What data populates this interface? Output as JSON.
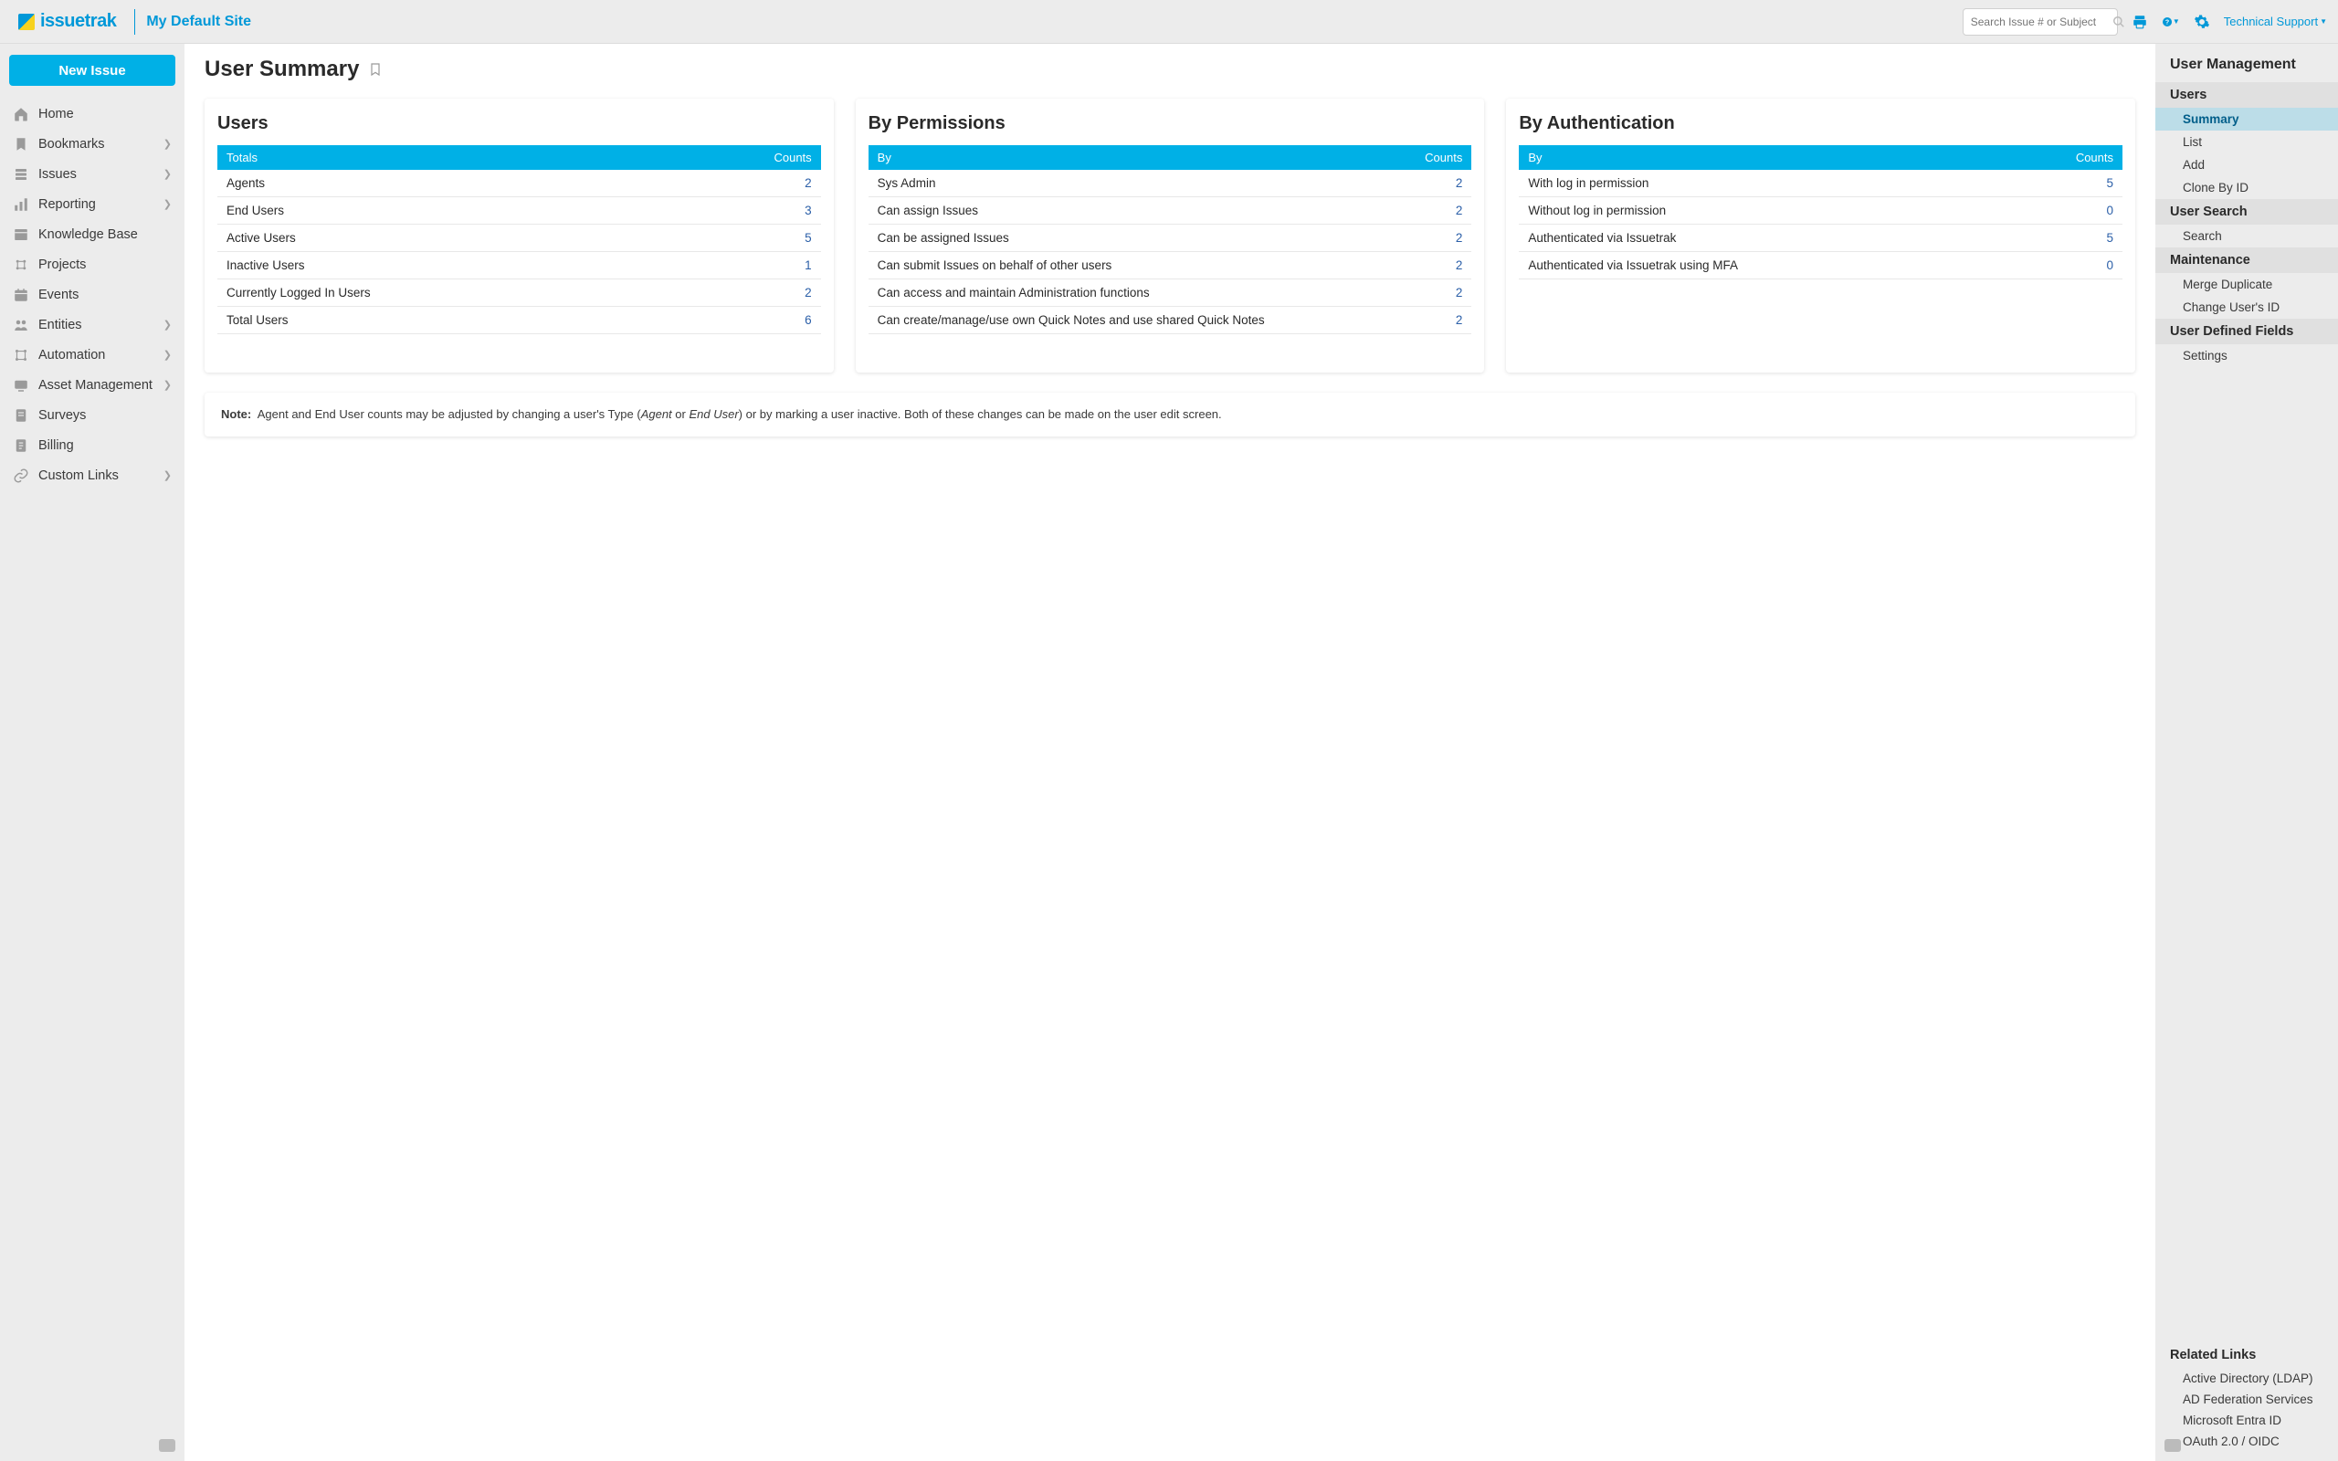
{
  "topbar": {
    "logo_text": "issuetrak",
    "site_name": "My Default Site",
    "search_placeholder": "Search Issue # or Subject",
    "tech_support": "Technical Support"
  },
  "left_nav": {
    "new_issue": "New Issue",
    "items": [
      {
        "label": "Home",
        "icon": "home",
        "expandable": false
      },
      {
        "label": "Bookmarks",
        "icon": "bookmark",
        "expandable": true
      },
      {
        "label": "Issues",
        "icon": "issues",
        "expandable": true
      },
      {
        "label": "Reporting",
        "icon": "reporting",
        "expandable": true
      },
      {
        "label": "Knowledge Base",
        "icon": "kb",
        "expandable": false
      },
      {
        "label": "Projects",
        "icon": "projects",
        "expandable": false
      },
      {
        "label": "Events",
        "icon": "events",
        "expandable": false
      },
      {
        "label": "Entities",
        "icon": "entities",
        "expandable": true
      },
      {
        "label": "Automation",
        "icon": "automation",
        "expandable": true
      },
      {
        "label": "Asset Management",
        "icon": "assets",
        "expandable": true
      },
      {
        "label": "Surveys",
        "icon": "surveys",
        "expandable": false
      },
      {
        "label": "Billing",
        "icon": "billing",
        "expandable": false
      },
      {
        "label": "Custom Links",
        "icon": "links",
        "expandable": true
      }
    ]
  },
  "page": {
    "title": "User Summary"
  },
  "cards": {
    "users": {
      "title": "Users",
      "head_l": "Totals",
      "head_r": "Counts",
      "rows": [
        {
          "label": "Agents",
          "count": "2"
        },
        {
          "label": "End Users",
          "count": "3"
        },
        {
          "label": "Active Users",
          "count": "5"
        },
        {
          "label": "Inactive Users",
          "count": "1"
        },
        {
          "label": "Currently Logged In Users",
          "count": "2"
        },
        {
          "label": "Total Users",
          "count": "6"
        }
      ]
    },
    "permissions": {
      "title": "By Permissions",
      "head_l": "By",
      "head_r": "Counts",
      "rows": [
        {
          "label": "Sys Admin",
          "count": "2"
        },
        {
          "label": "Can assign Issues",
          "count": "2"
        },
        {
          "label": "Can be assigned Issues",
          "count": "2"
        },
        {
          "label": "Can submit Issues on behalf of other users",
          "count": "2"
        },
        {
          "label": "Can access and maintain Administration functions",
          "count": "2"
        },
        {
          "label": "Can create/manage/use own Quick Notes and use shared Quick Notes",
          "count": "2"
        }
      ]
    },
    "auth": {
      "title": "By Authentication",
      "head_l": "By",
      "head_r": "Counts",
      "rows": [
        {
          "label": "With log in permission",
          "count": "5"
        },
        {
          "label": "Without log in permission",
          "count": "0"
        },
        {
          "label": "Authenticated via Issuetrak",
          "count": "5"
        },
        {
          "label": "Authenticated via Issuetrak using MFA",
          "count": "0"
        }
      ]
    }
  },
  "note": {
    "label": "Note:",
    "pre": "Agent and End User counts may be adjusted by changing a user's Type (",
    "em1": "Agent",
    "mid": " or ",
    "em2": "End User",
    "post": ") or by marking a user inactive. Both of these changes can be made on the user edit screen."
  },
  "right_nav": {
    "title": "User Management",
    "sections": [
      {
        "head": "Users",
        "items": [
          {
            "label": "Summary",
            "active": true
          },
          {
            "label": "List",
            "active": false
          },
          {
            "label": "Add",
            "active": false
          },
          {
            "label": "Clone By ID",
            "active": false
          }
        ]
      },
      {
        "head": "User Search",
        "items": [
          {
            "label": "Search",
            "active": false
          }
        ]
      },
      {
        "head": "Maintenance",
        "items": [
          {
            "label": "Merge Duplicate",
            "active": false
          },
          {
            "label": "Change User's ID",
            "active": false
          }
        ]
      },
      {
        "head": "User Defined Fields",
        "items": [
          {
            "label": "Settings",
            "active": false
          }
        ]
      }
    ],
    "related_title": "Related Links",
    "related": [
      {
        "label": "Active Directory (LDAP)"
      },
      {
        "label": "AD Federation Services"
      },
      {
        "label": "Microsoft Entra ID"
      },
      {
        "label": "OAuth 2.0 / OIDC"
      }
    ]
  }
}
